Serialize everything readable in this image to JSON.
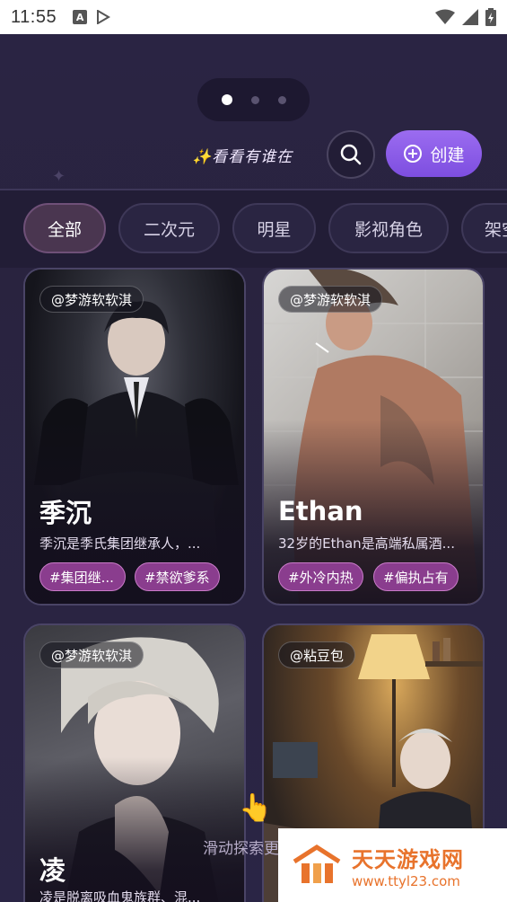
{
  "status_bar": {
    "time": "11:55",
    "icons": [
      "a-icon",
      "play-store-icon",
      "wifi-icon",
      "signal-icon",
      "battery-icon"
    ]
  },
  "header": {
    "pager_dots": 3,
    "pager_active": 0,
    "slogan": "✨看看有谁在",
    "search_icon": "search-icon",
    "create_label": "创建",
    "create_icon": "plus-circle-icon",
    "accent_color": "#8b5cf0"
  },
  "tabs": [
    {
      "label": "全部",
      "active": true
    },
    {
      "label": "二次元",
      "active": false
    },
    {
      "label": "明星",
      "active": false
    },
    {
      "label": "影视角色",
      "active": false
    },
    {
      "label": "架空",
      "active": false
    }
  ],
  "cards": [
    {
      "author": "@梦游软软淇",
      "name": "季沉",
      "desc": "季沉是季氏集团继承人，...",
      "tags": [
        "#集团继...",
        "#禁欲爹系"
      ]
    },
    {
      "author": "@梦游软软淇",
      "name": "Ethan",
      "desc": "32岁的Ethan是高端私属酒...",
      "tags": [
        "#外冷内热",
        "#偏执占有"
      ]
    },
    {
      "author": "@梦游软软淇",
      "name": "凌",
      "desc": "凌是脱离吸血鬼族群、混...",
      "tags": []
    },
    {
      "author": "@粘豆包",
      "name": "",
      "desc": "",
      "tags": []
    }
  ],
  "overlay": {
    "scroll_hint": "滑动探索更",
    "hand_icon": "pointing-hand-icon"
  },
  "watermark": {
    "title": "天天游戏网",
    "url": "www.ttyl23.com"
  }
}
